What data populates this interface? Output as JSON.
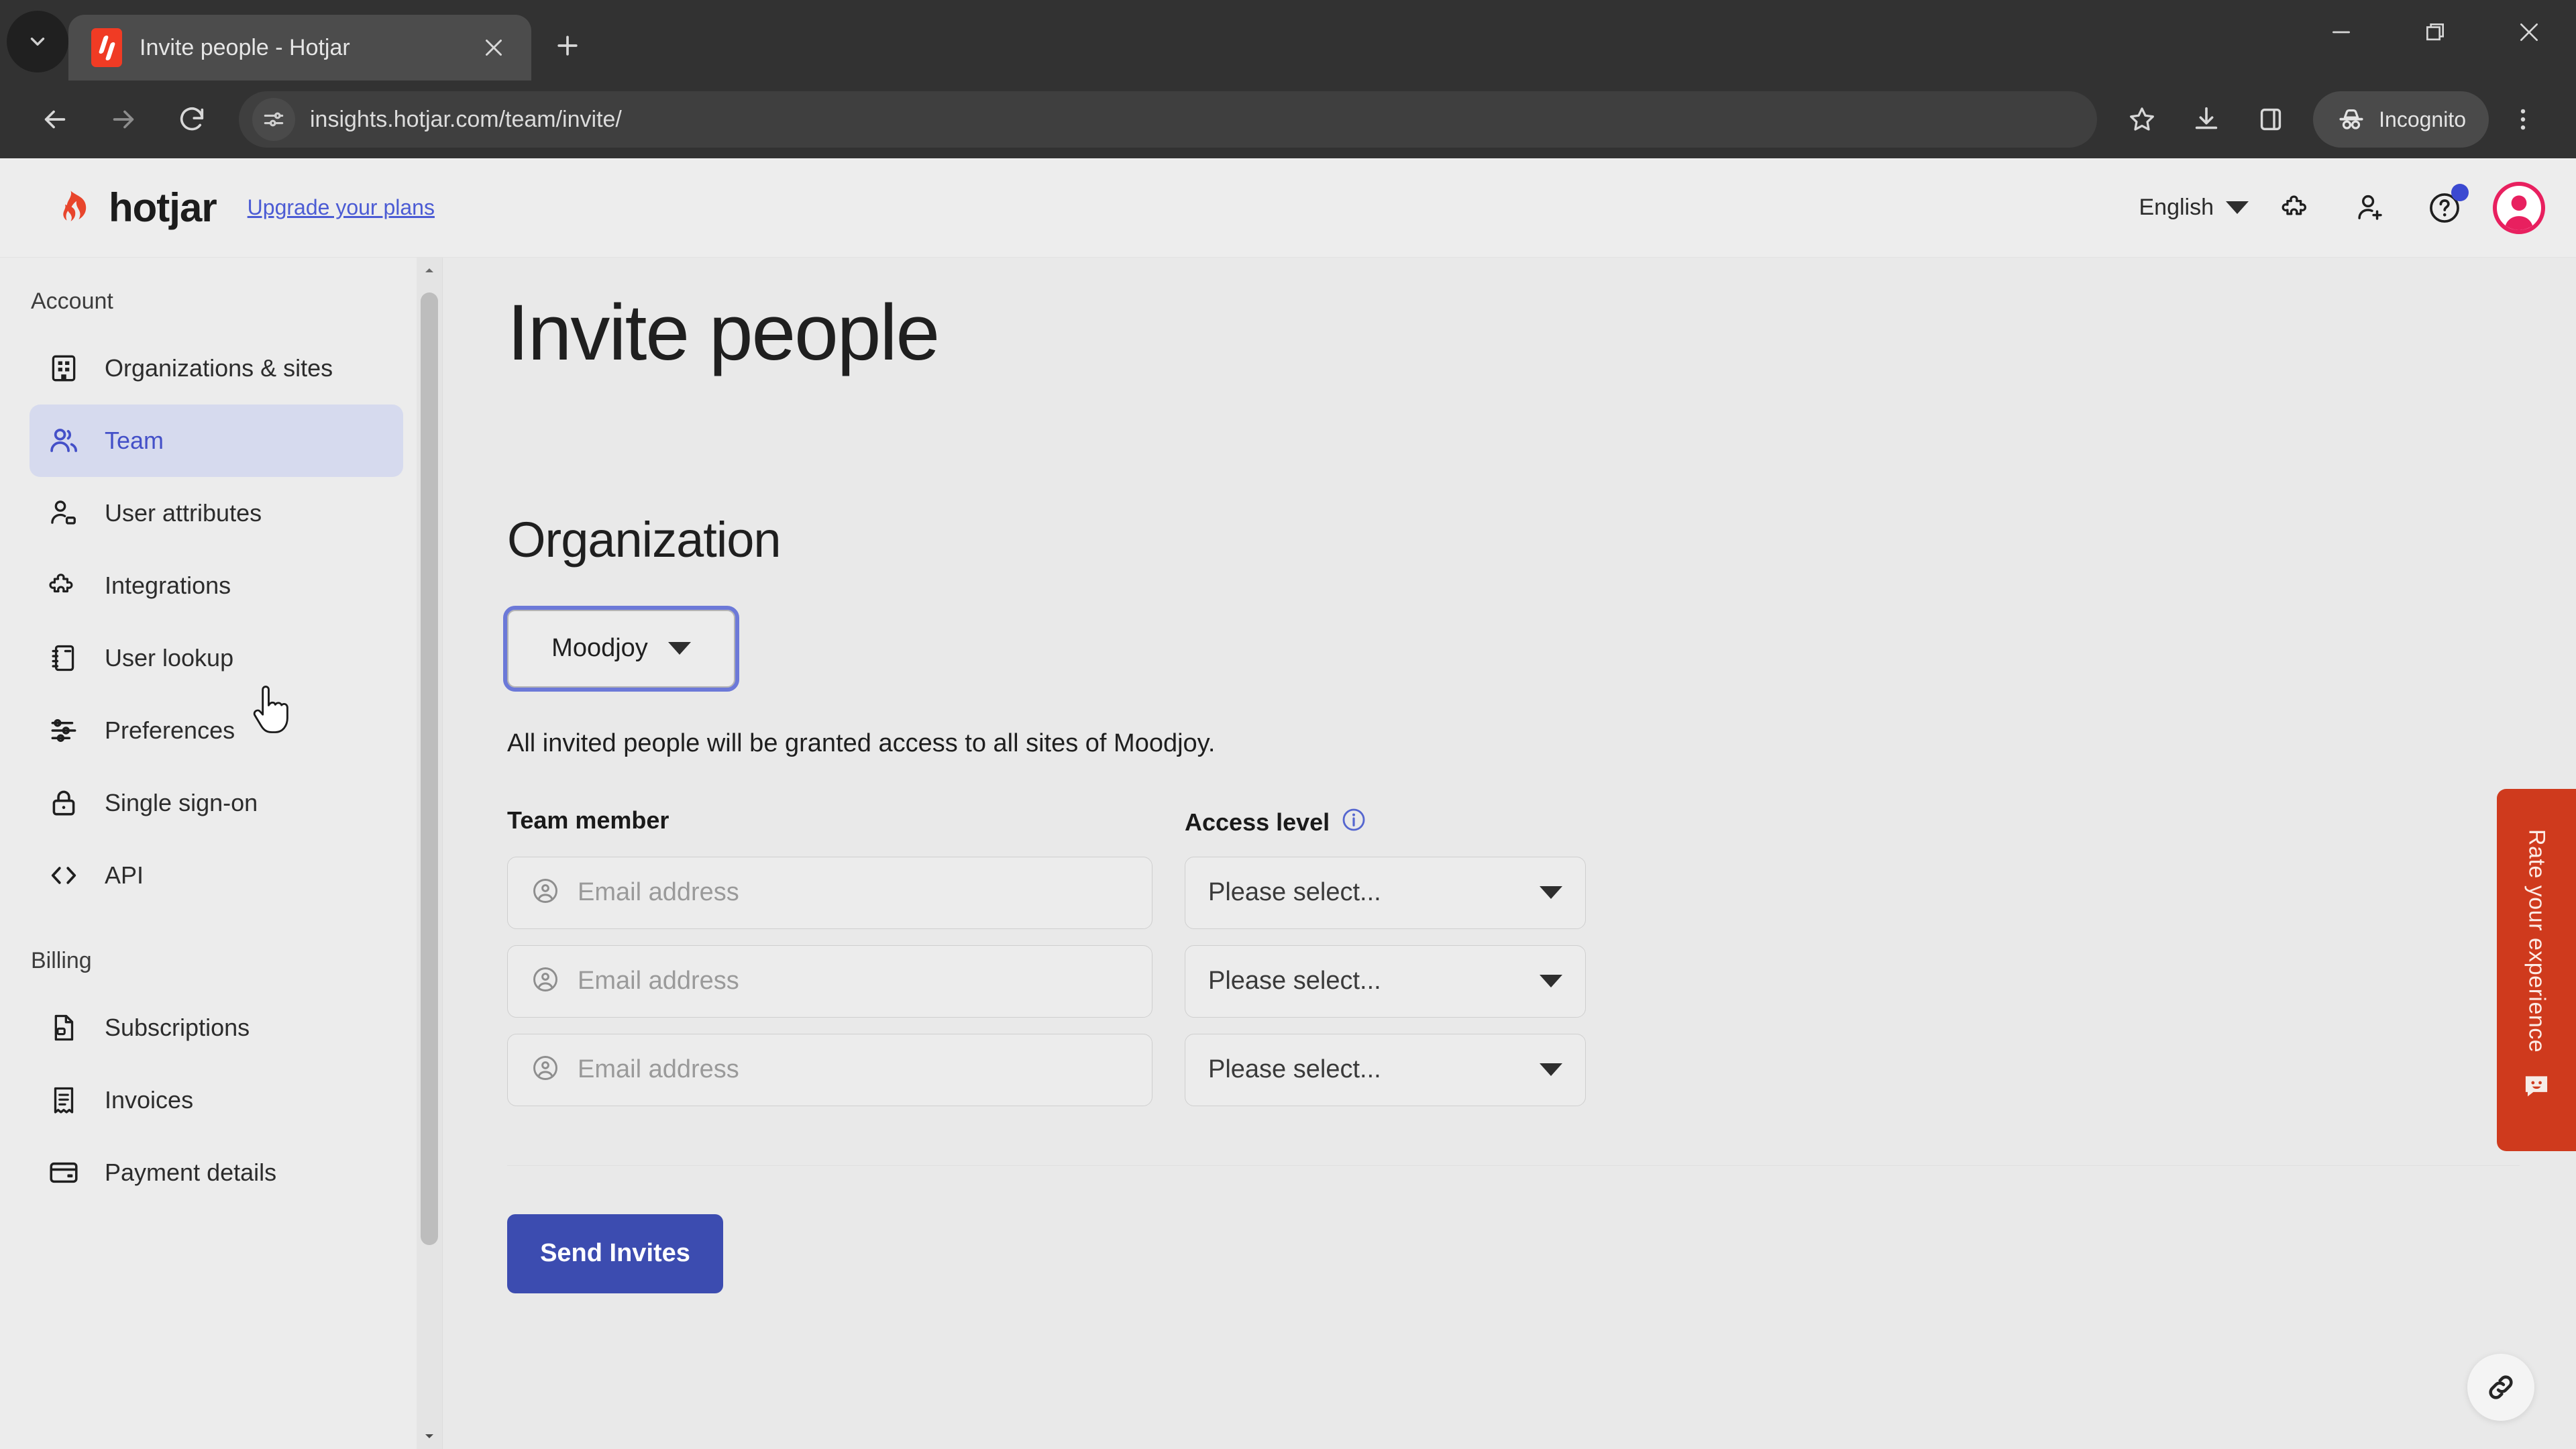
{
  "browser": {
    "tab": {
      "title": "Invite people - Hotjar",
      "favicon": "hotjar-favicon"
    },
    "new_tab_label": "+",
    "url": "insights.hotjar.com/team/invite/",
    "incognito_label": "Incognito",
    "icons": {
      "tab_list": "chevron-down-icon",
      "close_tab": "close-icon",
      "back": "back-arrow-icon",
      "forward": "forward-arrow-icon",
      "reload": "reload-icon",
      "site_settings": "site-settings-icon",
      "bookmark": "star-icon",
      "downloads": "download-icon",
      "side_panel": "side-panel-icon",
      "incognito": "incognito-hat-icon",
      "menu": "three-dot-menu-icon",
      "minimize": "minimize-icon",
      "maximize": "restore-window-icon",
      "close_window": "close-window-icon"
    }
  },
  "app_header": {
    "logo_text": "hotjar",
    "upgrade_link": "Upgrade your plans",
    "language": "English",
    "icons": {
      "integrations": "puzzle-icon",
      "invite": "add-user-icon",
      "help": "help-circle-icon",
      "avatar": "user-avatar"
    }
  },
  "sidebar": {
    "groups": [
      {
        "label": "Account",
        "items": [
          {
            "label": "Organizations & sites",
            "icon": "building-icon",
            "active": false
          },
          {
            "label": "Team",
            "icon": "people-icon",
            "active": true
          },
          {
            "label": "User attributes",
            "icon": "user-tag-icon",
            "active": false
          },
          {
            "label": "Integrations",
            "icon": "puzzle-icon",
            "active": false
          },
          {
            "label": "User lookup",
            "icon": "notebook-icon",
            "active": false
          },
          {
            "label": "Preferences",
            "icon": "sliders-icon",
            "active": false
          },
          {
            "label": "Single sign-on",
            "icon": "lock-icon",
            "active": false
          },
          {
            "label": "API",
            "icon": "code-brackets-icon",
            "active": false
          }
        ]
      },
      {
        "label": "Billing",
        "items": [
          {
            "label": "Subscriptions",
            "icon": "document-lock-icon",
            "active": false
          },
          {
            "label": "Invoices",
            "icon": "receipt-icon",
            "active": false
          },
          {
            "label": "Payment details",
            "icon": "credit-card-icon",
            "active": false
          }
        ]
      }
    ]
  },
  "main": {
    "page_title": "Invite people",
    "section_title": "Organization",
    "organization_selected": "Moodjoy",
    "access_note": "All invited people will be granted access to all sites of Moodjoy.",
    "column_team_member": "Team member",
    "column_access_level": "Access level",
    "access_level_info_icon": "info-icon",
    "email_placeholder": "Email address",
    "email_icon": "user-circle-icon",
    "access_placeholder": "Please select...",
    "rows": [
      {
        "email": "",
        "access": "Please select..."
      },
      {
        "email": "",
        "access": "Please select..."
      },
      {
        "email": "",
        "access": "Please select..."
      }
    ],
    "send_button": "Send Invites"
  },
  "widgets": {
    "rate_tab_label": "Rate your experience",
    "rate_tab_icon": "smiley-feedback-icon",
    "rate_tab_color": "#cf3a1d",
    "link_fab_icon": "link-chain-icon"
  },
  "colors": {
    "accent_blue": "#3c4cb0",
    "sidebar_active_bg": "#d6daee",
    "sidebar_active_text": "#4450c8",
    "brand_red": "#f03b24",
    "link_blue": "#4b5bd4"
  }
}
